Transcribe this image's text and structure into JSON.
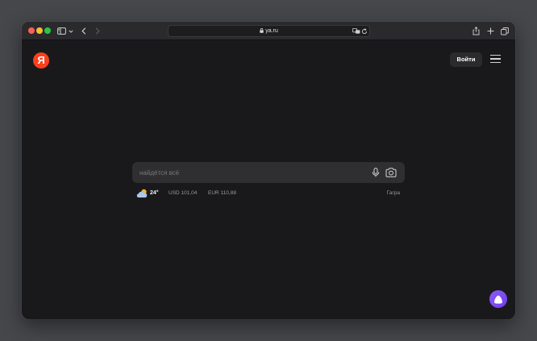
{
  "browser": {
    "url_host": "ya.ru"
  },
  "header": {
    "logo_letter": "Я",
    "login_label": "Войти"
  },
  "search": {
    "placeholder": "найдётся всё"
  },
  "info": {
    "temperature": "24°",
    "usd": "USD 101,04",
    "eur": "EUR 110,88",
    "city": "Гагра"
  },
  "colors": {
    "brand_red": "#fc3f1d",
    "alice_purple": "#7c4af4",
    "page_background": "#19191b"
  },
  "icons": {
    "toolbar": [
      "sidebar-icon",
      "chevron-down-icon",
      "back-icon",
      "forward-icon",
      "lock-icon",
      "translate-icon",
      "reload-icon",
      "share-icon",
      "new-tab-icon",
      "tabs-overview-icon"
    ],
    "page": [
      "menu-icon",
      "microphone-icon",
      "camera-icon",
      "weather-icon",
      "alice-icon"
    ]
  }
}
